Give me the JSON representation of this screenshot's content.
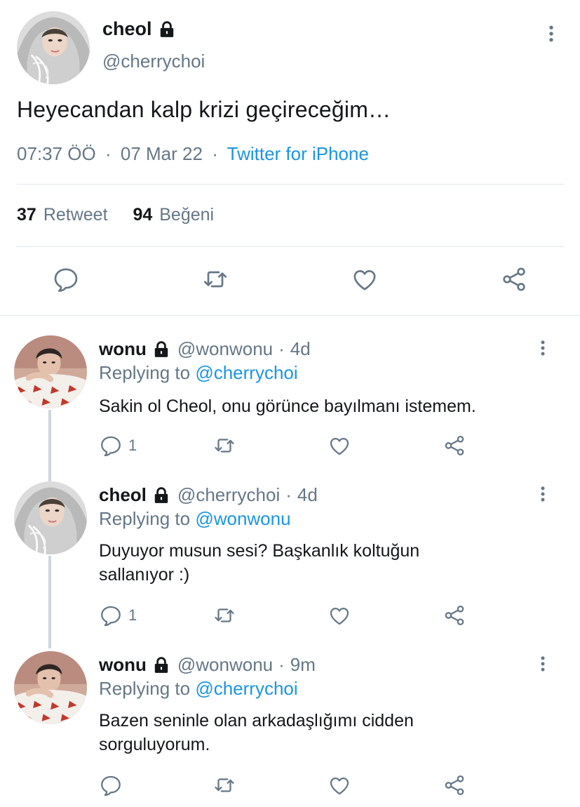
{
  "main_tweet": {
    "display_name": "cheol",
    "handle": "@cherrychoi",
    "text": "Heyecandan kalp krizi geçireceğim…",
    "time": "07:37 ÖÖ",
    "date": "07 Mar 22",
    "source": "Twitter for iPhone",
    "retweet_count": "37",
    "retweet_label": "Retweet",
    "like_count": "94",
    "like_label": "Beğeni",
    "separator": "·"
  },
  "replies": [
    {
      "display_name": "wonu",
      "handle": "@wonwonu",
      "time_ago": "4d",
      "replying_prefix": "Replying to",
      "replying_to": "@cherrychoi",
      "text": "Sakin ol Cheol, onu görünce bayılmanı istemem.",
      "reply_count": "1",
      "avatar": "wonu-avatar"
    },
    {
      "display_name": "cheol",
      "handle": "@cherrychoi",
      "time_ago": "4d",
      "replying_prefix": "Replying to",
      "replying_to": "@wonwonu",
      "text": "Duyuyor musun sesi? Başkanlık koltuğun sallanıyor :)",
      "reply_count": "1",
      "avatar": "cheol-avatar"
    },
    {
      "display_name": "wonu",
      "handle": "@wonwonu",
      "time_ago": "9m",
      "replying_prefix": "Replying to",
      "replying_to": "@cherrychoi",
      "text": "Bazen seninle olan arkadaşlığımı cidden sorguluyorum.",
      "reply_count": "",
      "avatar": "wonu-avatar"
    }
  ],
  "colors": {
    "text": "#14171a",
    "secondary": "#657786",
    "link": "#1b95e0",
    "divider": "#e1e8ed",
    "thread_line": "#ccd6dd"
  },
  "icons": [
    "lock-icon",
    "more-vertical-icon",
    "reply-icon",
    "retweet-icon",
    "like-icon",
    "share-icon"
  ]
}
